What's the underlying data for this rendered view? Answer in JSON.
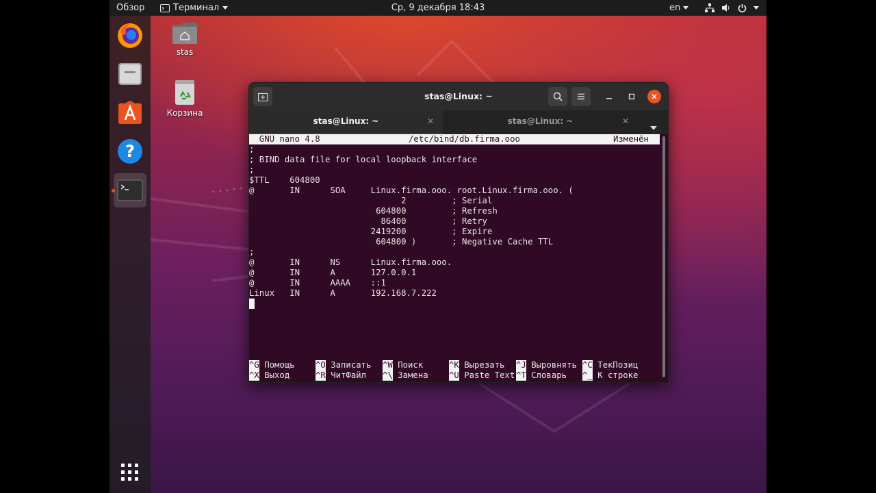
{
  "topbar": {
    "activities": "Обзор",
    "app_menu": "Терминал",
    "clock": "Ср, 9 декабря  18:43",
    "lang": "en"
  },
  "desktop": {
    "home_label": "stas",
    "trash_label": "Корзина"
  },
  "window": {
    "title": "stas@Linux: ~",
    "tabs": [
      {
        "label": "stas@Linux: ~",
        "active": true
      },
      {
        "label": "stas@Linux: ~",
        "active": false
      }
    ]
  },
  "nano": {
    "header_left": "  GNU nano 4.8",
    "header_center": "/etc/bind/db.firma.ooo",
    "header_right": "Изменён",
    "lines": [
      ";",
      "; BIND data file for local loopback interface",
      ";",
      "$TTL    604800",
      "@       IN      SOA     Linux.firma.ooo. root.Linux.firma.ooo. (",
      "                              2         ; Serial",
      "                         604800         ; Refresh",
      "                          86400         ; Retry",
      "                        2419200         ; Expire",
      "                         604800 )       ; Negative Cache TTL",
      ";",
      "@       IN      NS      Linux.firma.ooo.",
      "@       IN      A       127.0.0.1",
      "@       IN      AAAA    ::1",
      "Linux   IN      A       192.168.7.222"
    ],
    "shortcuts": [
      {
        "key": "^G",
        "label": " Помощь"
      },
      {
        "key": "^O",
        "label": " Записать"
      },
      {
        "key": "^W",
        "label": " Поиск"
      },
      {
        "key": "^K",
        "label": " Вырезать"
      },
      {
        "key": "^J",
        "label": " Выровнять"
      },
      {
        "key": "^C",
        "label": " ТекПозиц"
      },
      {
        "key": "^X",
        "label": " Выход"
      },
      {
        "key": "^R",
        "label": " ЧитФайл"
      },
      {
        "key": "^\\",
        "label": " Замена"
      },
      {
        "key": "^U",
        "label": " Paste Text"
      },
      {
        "key": "^T",
        "label": " Словарь"
      },
      {
        "key": "^_",
        "label": " К строке"
      }
    ]
  },
  "colors": {
    "terminal_bg": "#300a24",
    "accent": "#e95420",
    "topbar_bg": "#1d1d1d"
  }
}
